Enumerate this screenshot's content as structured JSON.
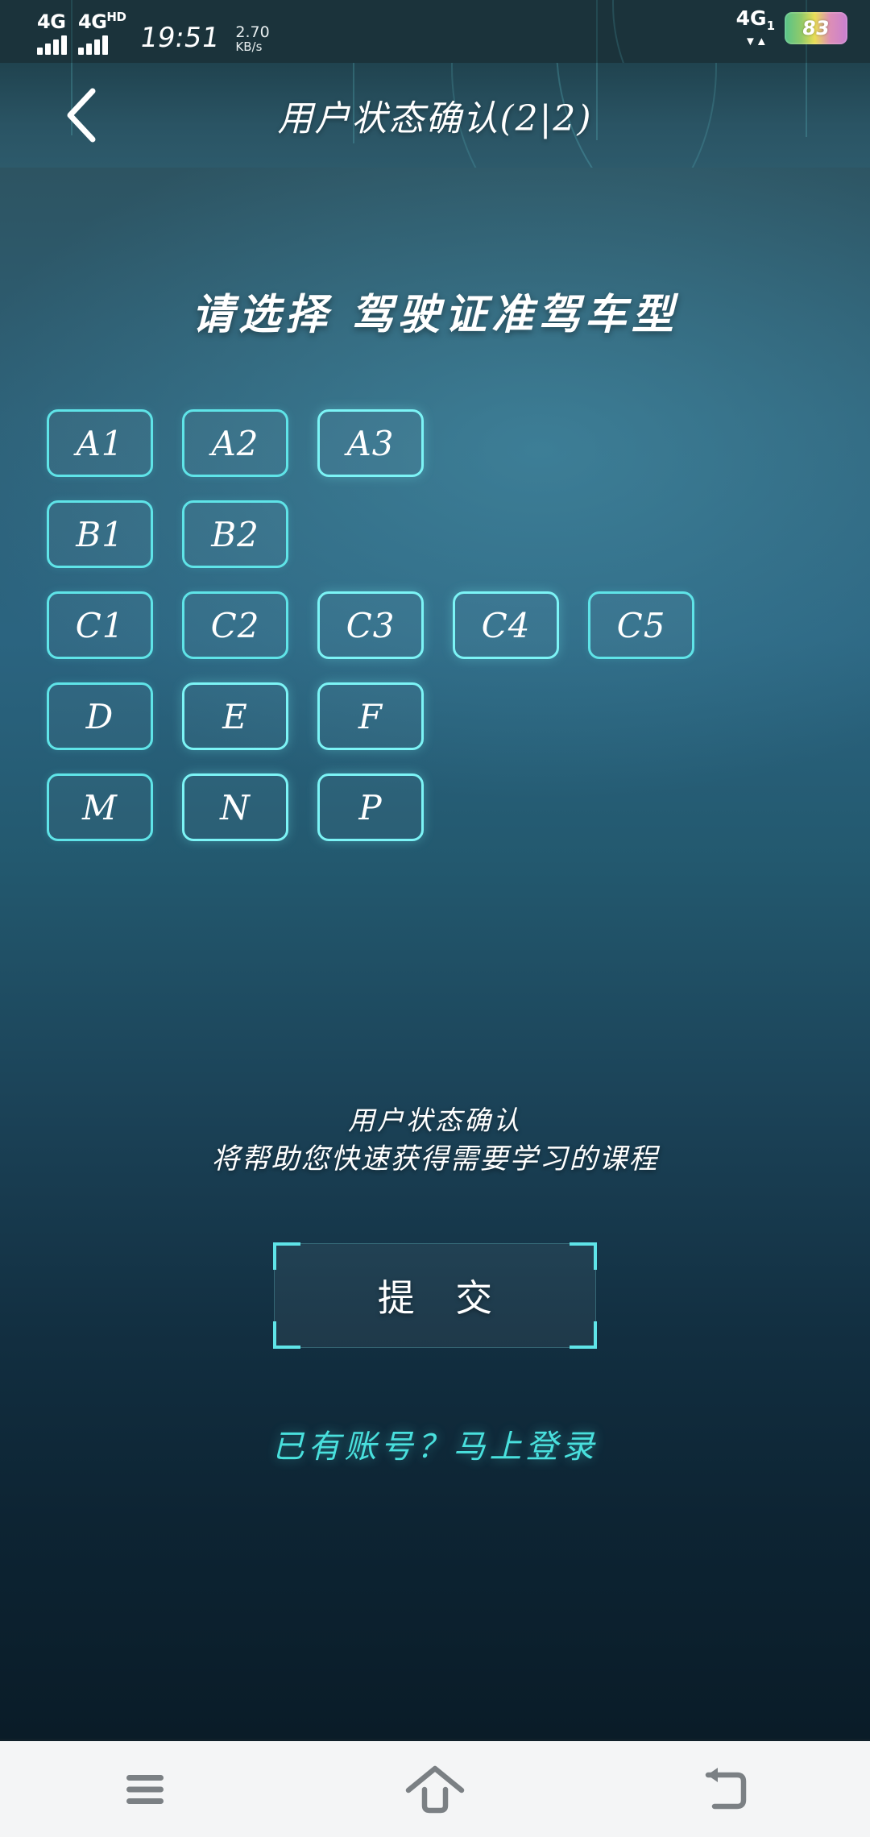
{
  "status_bar": {
    "sim1_label": "4G",
    "sim2_label": "4G",
    "sim2_sup": "HD",
    "clock": "19:51",
    "net_speed_value": "2.70",
    "net_speed_unit": "KB/s",
    "network_label": "4G",
    "network_sub": "1",
    "data_arrows": "▼▲",
    "battery_percent": "83",
    "accent_cyan": "#5fe4e8",
    "bar_bg": "#1b333b"
  },
  "header": {
    "back_icon": "chevron-left-icon",
    "title": "用户状态确认(2|2)"
  },
  "main": {
    "select_title": "请选择 驾驶证准驾车型",
    "license_rows": [
      [
        "A1",
        "A2",
        "A3"
      ],
      [
        "B1",
        "B2"
      ],
      [
        "C1",
        "C2",
        "C3",
        "C4",
        "C5"
      ],
      [
        "D",
        "E",
        "F"
      ],
      [
        "M",
        "N",
        "P"
      ]
    ],
    "hint_line1": "用户状态确认",
    "hint_line2": "将帮助您快速获得需要学习的课程",
    "submit_label": "提 交",
    "login_link": "已有账号？马上登录"
  },
  "nav_bar": {
    "recents_icon": "menu-icon",
    "home_icon": "home-icon",
    "back_icon": "back-arrow-icon",
    "icon_color": "#7b8084",
    "background": "#f4f5f6"
  }
}
